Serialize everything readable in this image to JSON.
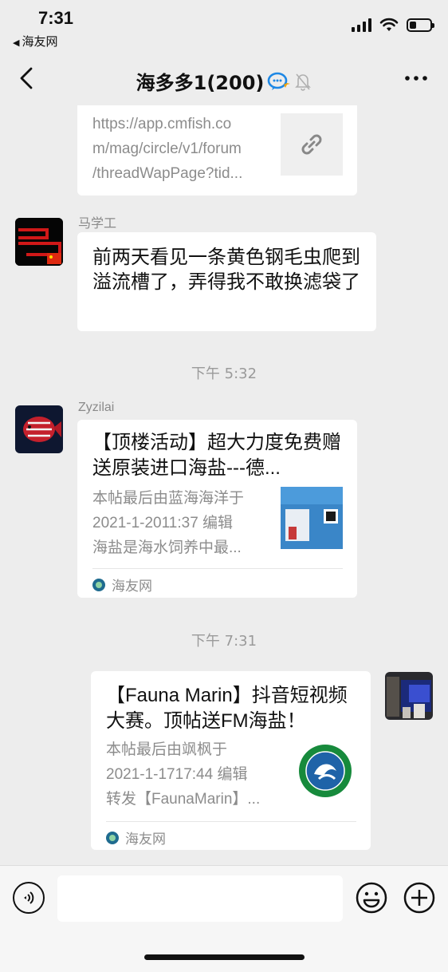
{
  "status_bar": {
    "time": "7:31",
    "back_app": "海友网"
  },
  "nav": {
    "title": "海多多1(200)"
  },
  "messages": [
    {
      "type": "link-card-partial",
      "description": "https://app.cmfish.co\nm/mag/circle/v1/forum\n/threadWapPage?tid..."
    },
    {
      "type": "text",
      "sender": "马学工",
      "text": "前两天看见一条黄色钢毛虫爬到溢流槽了，弄得我不敢换滤袋了"
    },
    {
      "type": "timestamp",
      "text": "下午 5:32"
    },
    {
      "type": "share-card",
      "sender": "Zyzilai",
      "title": "【顶楼活动】超大力度免费赠送原装进口海盐---德...",
      "desc_lines": [
        "本帖最后由蓝海海洋于",
        "2021-1-2011:37 编辑",
        "海盐是海水饲养中最..."
      ],
      "source": "海友网"
    },
    {
      "type": "timestamp",
      "text": "下午 7:31"
    },
    {
      "type": "share-card-self",
      "title": "【Fauna Marin】抖音短视频大赛。顶帖送FM海盐！",
      "desc_lines": [
        "本帖最后由飒枫于",
        "2021-1-1717:44 编辑",
        "转发【FaunaMarin】..."
      ],
      "source": "海友网"
    }
  ],
  "input_bar": {
    "placeholder": ""
  },
  "colors": {
    "background": "#ededed",
    "bubble": "#ffffff",
    "accent_blue": "#1e88e5"
  }
}
